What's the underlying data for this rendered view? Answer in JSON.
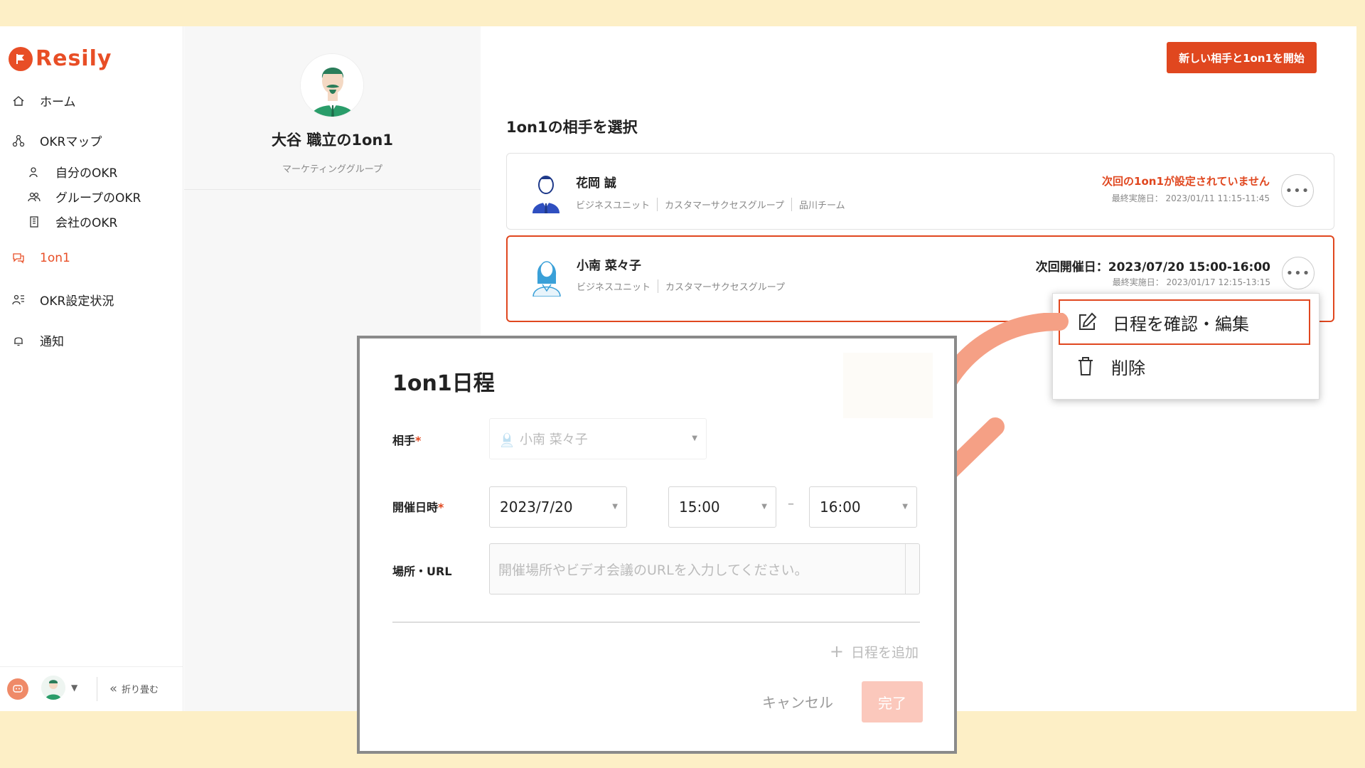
{
  "brand": {
    "name": "Resily",
    "color": "#e84e26"
  },
  "sidebar": {
    "items": [
      {
        "label": "ホーム",
        "icon": "home-icon"
      },
      {
        "label": "OKRマップ",
        "icon": "okr-map-icon"
      },
      {
        "label": "自分のOKR",
        "icon": "user-icon"
      },
      {
        "label": "グループのOKR",
        "icon": "group-icon"
      },
      {
        "label": "会社のOKR",
        "icon": "building-icon"
      },
      {
        "label": "1on1",
        "icon": "chat-icon",
        "active": true
      },
      {
        "label": "OKR設定状況",
        "icon": "status-icon"
      },
      {
        "label": "通知",
        "icon": "bell-icon"
      }
    ],
    "collapse_label": "折り畳む"
  },
  "profile": {
    "name": "大谷 職立の1on1",
    "group": "マーケティンググループ"
  },
  "header": {
    "new_button": "新しい相手と1on1を開始"
  },
  "main": {
    "section_title": "1on1の相手を選択",
    "cards": [
      {
        "name": "花岡 誠",
        "tags": [
          "ビジネスユニット",
          "カスタマーサクセスグループ",
          "品川チーム"
        ],
        "status": "次回の1on1が設定されていません",
        "last": "最終実施日： 2023/01/11 11:15-11:45"
      },
      {
        "name": "小南 菜々子",
        "tags": [
          "ビジネスユニット",
          "カスタマーサクセスグループ"
        ],
        "status": "次回開催日：2023/07/20 15:00-16:00",
        "last": "最終実施日： 2023/01/17 12:15-13:15"
      }
    ]
  },
  "dropdown": {
    "items": [
      {
        "label": "日程を確認・編集",
        "icon": "edit-icon"
      },
      {
        "label": "削除",
        "icon": "trash-icon"
      }
    ]
  },
  "modal": {
    "title": "1on1日程",
    "partner_label": "相手",
    "partner_value": "小南 菜々子",
    "datetime_label": "開催日時",
    "date_value": "2023/7/20",
    "start_time": "15:00",
    "end_time": "16:00",
    "dash": "–",
    "place_label": "場所・URL",
    "place_placeholder": "開催場所やビデオ会議のURLを入力してください。",
    "add_date": "日程を追加",
    "cancel": "キャンセル",
    "done": "完了",
    "required_mark": "*"
  },
  "colors": {
    "accent": "#e0471f",
    "arrow": "#f5a085",
    "background": "#fdefc6"
  }
}
